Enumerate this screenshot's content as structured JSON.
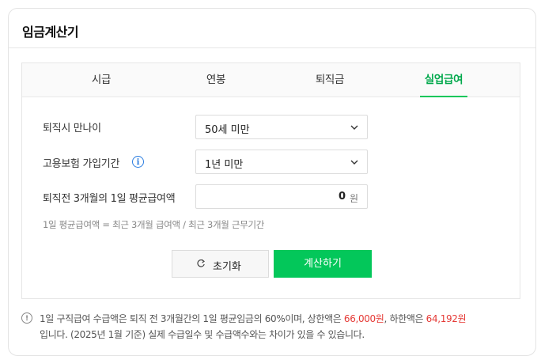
{
  "card": {
    "title": "임금계산기"
  },
  "tabs": [
    {
      "label": "시급",
      "active": false
    },
    {
      "label": "연봉",
      "active": false
    },
    {
      "label": "퇴직금",
      "active": false
    },
    {
      "label": "실업급여",
      "active": true
    }
  ],
  "form": {
    "age_label": "퇴직시 만나이",
    "age_value": "50세 미만",
    "period_label": "고용보험 가입기간",
    "info_icon": "i",
    "period_value": "1년 미만",
    "wage_label": "퇴직전 3개월의 1일 평균급여액",
    "wage_value": "0",
    "wage_unit": "원",
    "formula": "1일 평균급여액 = 최근 3개월 급여액 / 최근 3개월 근무기간"
  },
  "buttons": {
    "reset_label": "초기화",
    "calc_label": "계산하기"
  },
  "notice": {
    "icon": "!",
    "part1": "1일 구직급여 수급액은 퇴직 전 3개월간의 1일 평균임금의 60%이며, 상한액은 ",
    "upper": "66,000원",
    "part2": ", 하한액은 ",
    "lower": "64,192원",
    "part3": "입니다. (2025년 1월 기준) 실제 수급일수 및 수급액수와는 차이가 있을 수 있습니다."
  },
  "colors": {
    "accent": "#03c75a",
    "accent_text": "#03a94d",
    "info": "#2b7de0",
    "highlight": "#e53935"
  }
}
